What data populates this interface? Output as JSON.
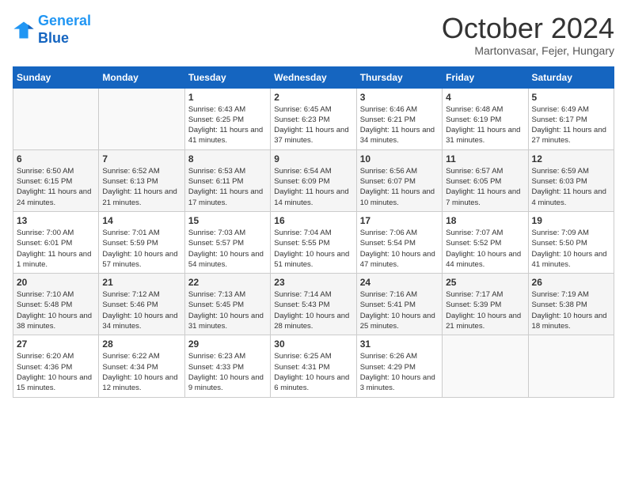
{
  "header": {
    "logo_line1": "General",
    "logo_line2": "Blue",
    "month": "October 2024",
    "location": "Martonvasar, Fejer, Hungary"
  },
  "weekdays": [
    "Sunday",
    "Monday",
    "Tuesday",
    "Wednesday",
    "Thursday",
    "Friday",
    "Saturday"
  ],
  "weeks": [
    [
      {
        "day": "",
        "info": ""
      },
      {
        "day": "",
        "info": ""
      },
      {
        "day": "1",
        "info": "Sunrise: 6:43 AM\nSunset: 6:25 PM\nDaylight: 11 hours and 41 minutes."
      },
      {
        "day": "2",
        "info": "Sunrise: 6:45 AM\nSunset: 6:23 PM\nDaylight: 11 hours and 37 minutes."
      },
      {
        "day": "3",
        "info": "Sunrise: 6:46 AM\nSunset: 6:21 PM\nDaylight: 11 hours and 34 minutes."
      },
      {
        "day": "4",
        "info": "Sunrise: 6:48 AM\nSunset: 6:19 PM\nDaylight: 11 hours and 31 minutes."
      },
      {
        "day": "5",
        "info": "Sunrise: 6:49 AM\nSunset: 6:17 PM\nDaylight: 11 hours and 27 minutes."
      }
    ],
    [
      {
        "day": "6",
        "info": "Sunrise: 6:50 AM\nSunset: 6:15 PM\nDaylight: 11 hours and 24 minutes."
      },
      {
        "day": "7",
        "info": "Sunrise: 6:52 AM\nSunset: 6:13 PM\nDaylight: 11 hours and 21 minutes."
      },
      {
        "day": "8",
        "info": "Sunrise: 6:53 AM\nSunset: 6:11 PM\nDaylight: 11 hours and 17 minutes."
      },
      {
        "day": "9",
        "info": "Sunrise: 6:54 AM\nSunset: 6:09 PM\nDaylight: 11 hours and 14 minutes."
      },
      {
        "day": "10",
        "info": "Sunrise: 6:56 AM\nSunset: 6:07 PM\nDaylight: 11 hours and 10 minutes."
      },
      {
        "day": "11",
        "info": "Sunrise: 6:57 AM\nSunset: 6:05 PM\nDaylight: 11 hours and 7 minutes."
      },
      {
        "day": "12",
        "info": "Sunrise: 6:59 AM\nSunset: 6:03 PM\nDaylight: 11 hours and 4 minutes."
      }
    ],
    [
      {
        "day": "13",
        "info": "Sunrise: 7:00 AM\nSunset: 6:01 PM\nDaylight: 11 hours and 1 minute."
      },
      {
        "day": "14",
        "info": "Sunrise: 7:01 AM\nSunset: 5:59 PM\nDaylight: 10 hours and 57 minutes."
      },
      {
        "day": "15",
        "info": "Sunrise: 7:03 AM\nSunset: 5:57 PM\nDaylight: 10 hours and 54 minutes."
      },
      {
        "day": "16",
        "info": "Sunrise: 7:04 AM\nSunset: 5:55 PM\nDaylight: 10 hours and 51 minutes."
      },
      {
        "day": "17",
        "info": "Sunrise: 7:06 AM\nSunset: 5:54 PM\nDaylight: 10 hours and 47 minutes."
      },
      {
        "day": "18",
        "info": "Sunrise: 7:07 AM\nSunset: 5:52 PM\nDaylight: 10 hours and 44 minutes."
      },
      {
        "day": "19",
        "info": "Sunrise: 7:09 AM\nSunset: 5:50 PM\nDaylight: 10 hours and 41 minutes."
      }
    ],
    [
      {
        "day": "20",
        "info": "Sunrise: 7:10 AM\nSunset: 5:48 PM\nDaylight: 10 hours and 38 minutes."
      },
      {
        "day": "21",
        "info": "Sunrise: 7:12 AM\nSunset: 5:46 PM\nDaylight: 10 hours and 34 minutes."
      },
      {
        "day": "22",
        "info": "Sunrise: 7:13 AM\nSunset: 5:45 PM\nDaylight: 10 hours and 31 minutes."
      },
      {
        "day": "23",
        "info": "Sunrise: 7:14 AM\nSunset: 5:43 PM\nDaylight: 10 hours and 28 minutes."
      },
      {
        "day": "24",
        "info": "Sunrise: 7:16 AM\nSunset: 5:41 PM\nDaylight: 10 hours and 25 minutes."
      },
      {
        "day": "25",
        "info": "Sunrise: 7:17 AM\nSunset: 5:39 PM\nDaylight: 10 hours and 21 minutes."
      },
      {
        "day": "26",
        "info": "Sunrise: 7:19 AM\nSunset: 5:38 PM\nDaylight: 10 hours and 18 minutes."
      }
    ],
    [
      {
        "day": "27",
        "info": "Sunrise: 6:20 AM\nSunset: 4:36 PM\nDaylight: 10 hours and 15 minutes."
      },
      {
        "day": "28",
        "info": "Sunrise: 6:22 AM\nSunset: 4:34 PM\nDaylight: 10 hours and 12 minutes."
      },
      {
        "day": "29",
        "info": "Sunrise: 6:23 AM\nSunset: 4:33 PM\nDaylight: 10 hours and 9 minutes."
      },
      {
        "day": "30",
        "info": "Sunrise: 6:25 AM\nSunset: 4:31 PM\nDaylight: 10 hours and 6 minutes."
      },
      {
        "day": "31",
        "info": "Sunrise: 6:26 AM\nSunset: 4:29 PM\nDaylight: 10 hours and 3 minutes."
      },
      {
        "day": "",
        "info": ""
      },
      {
        "day": "",
        "info": ""
      }
    ]
  ]
}
